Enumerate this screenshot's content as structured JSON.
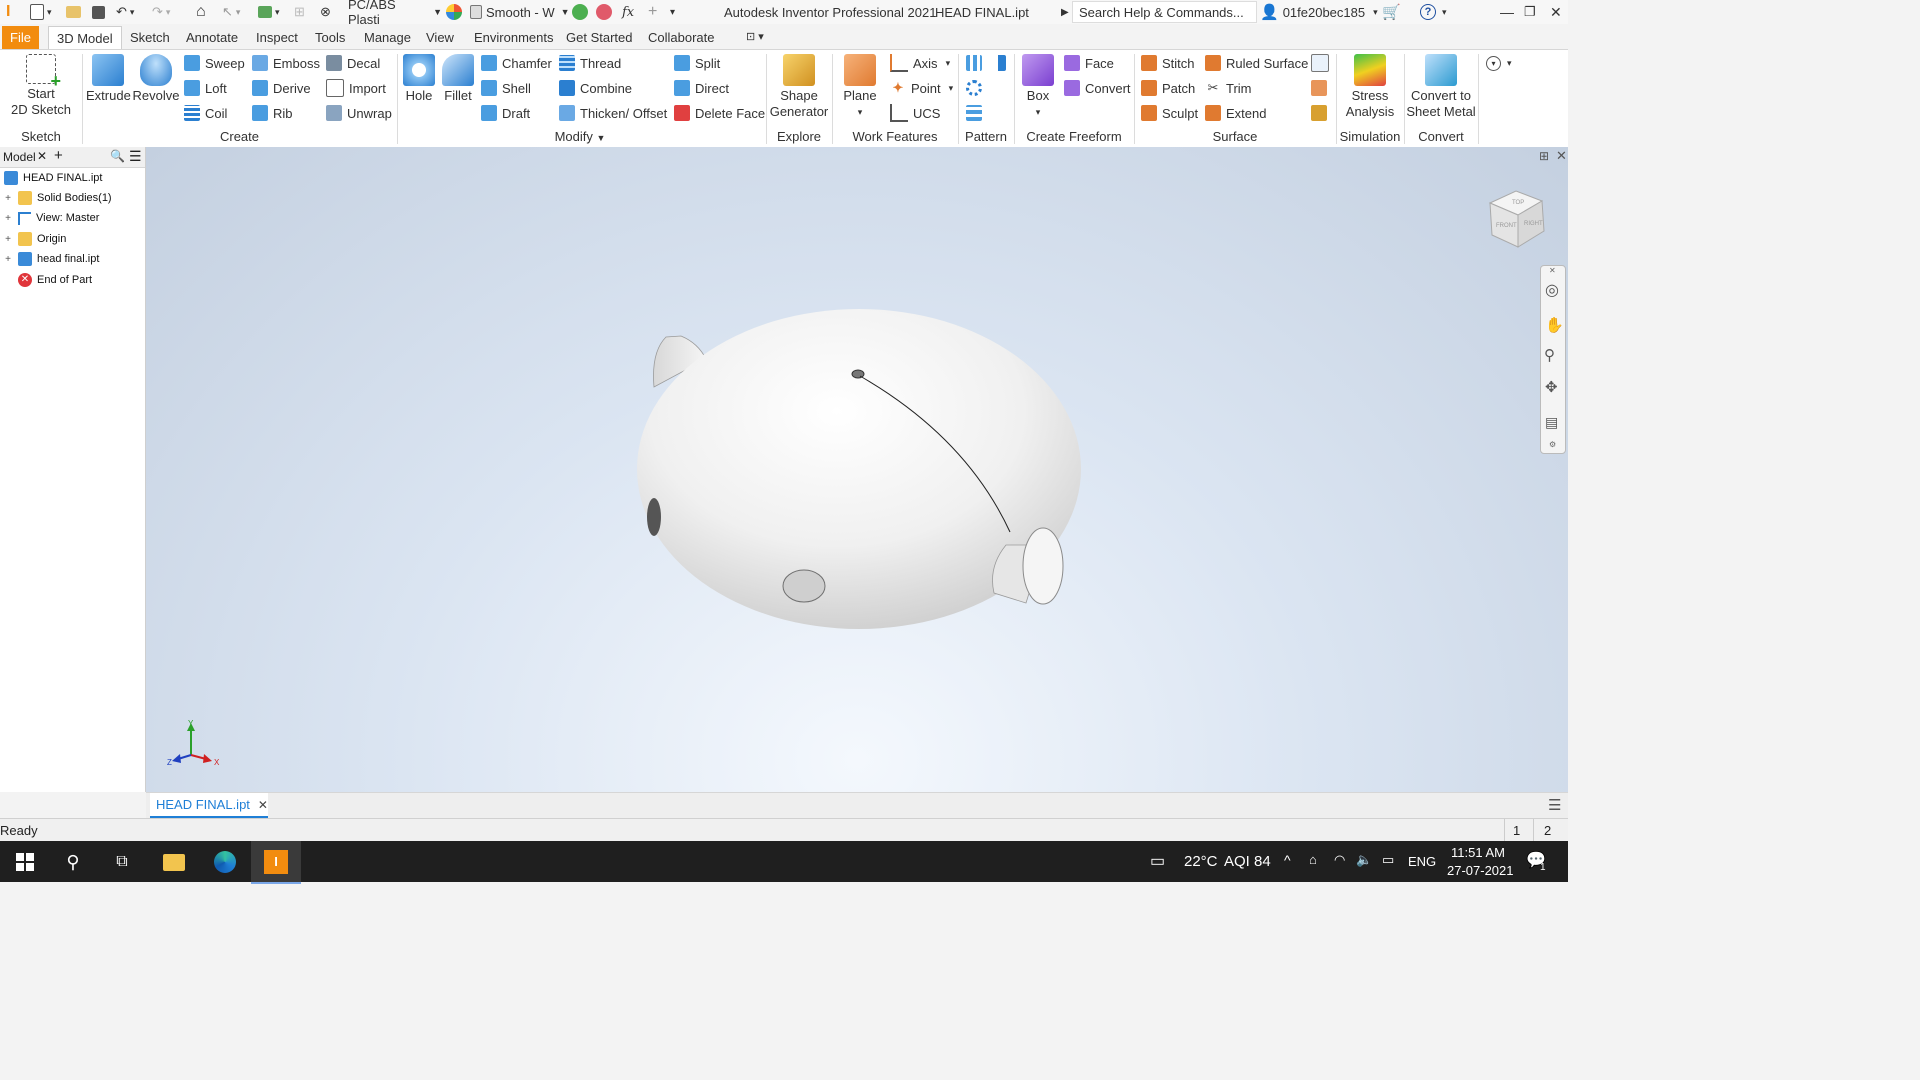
{
  "titlebar": {
    "material": "PC/ABS Plasti",
    "visual_style": "Smooth - W",
    "app_title": "Autodesk Inventor Professional 2021",
    "doc_title": "HEAD FINAL.ipt",
    "search_placeholder": "Search Help & Commands...",
    "user": "01fe20bec185"
  },
  "tabs": [
    {
      "label": "File"
    },
    {
      "label": "3D Model"
    },
    {
      "label": "Sketch"
    },
    {
      "label": "Annotate"
    },
    {
      "label": "Inspect"
    },
    {
      "label": "Tools"
    },
    {
      "label": "Manage"
    },
    {
      "label": "View"
    },
    {
      "label": "Environments"
    },
    {
      "label": "Get Started"
    },
    {
      "label": "Collaborate"
    }
  ],
  "ribbon": {
    "sketch": {
      "start_line1": "Start",
      "start_line2": "2D Sketch",
      "label": "Sketch"
    },
    "create": {
      "extrude": "Extrude",
      "revolve": "Revolve",
      "sweep": "Sweep",
      "loft": "Loft",
      "coil": "Coil",
      "emboss": "Emboss",
      "derive": "Derive",
      "rib": "Rib",
      "decal": "Decal",
      "import": "Import",
      "unwrap": "Unwrap",
      "label": "Create"
    },
    "modify": {
      "hole": "Hole",
      "fillet": "Fillet",
      "chamfer": "Chamfer",
      "shell": "Shell",
      "draft": "Draft",
      "thread": "Thread",
      "combine": "Combine",
      "thicken": "Thicken/ Offset",
      "split": "Split",
      "direct": "Direct",
      "delete_face": "Delete Face",
      "label": "Modify"
    },
    "explore": {
      "shape_line1": "Shape",
      "shape_line2": "Generator",
      "label": "Explore"
    },
    "work": {
      "plane": "Plane",
      "axis": "Axis",
      "point": "Point",
      "ucs": "UCS",
      "label": "Work Features"
    },
    "pattern": {
      "label": "Pattern"
    },
    "freeform": {
      "box": "Box",
      "face": "Face",
      "convert": "Convert",
      "label": "Create Freeform"
    },
    "surface": {
      "stitch": "Stitch",
      "patch": "Patch",
      "sculpt": "Sculpt",
      "ruled": "Ruled Surface",
      "trim": "Trim",
      "extend": "Extend",
      "label": "Surface"
    },
    "simulation": {
      "line1": "Stress",
      "line2": "Analysis",
      "label": "Simulation"
    },
    "convert": {
      "line1": "Convert to",
      "line2": "Sheet Metal",
      "label": "Convert"
    }
  },
  "browser": {
    "tab_label": "Model",
    "items": [
      {
        "label": "HEAD FINAL.ipt"
      },
      {
        "label": "Solid Bodies(1)"
      },
      {
        "label": "View: Master"
      },
      {
        "label": "Origin"
      },
      {
        "label": "head final.ipt"
      },
      {
        "label": "End of Part"
      }
    ]
  },
  "viewcube": {
    "top": "TOP",
    "front": "FRONT",
    "right": "RIGHT"
  },
  "triad": {
    "x": "X",
    "y": "Y",
    "z": "Z"
  },
  "doc_tab": {
    "label": "HEAD FINAL.ipt"
  },
  "status": {
    "text": "Ready",
    "count1": "1",
    "count2": "2"
  },
  "taskbar": {
    "weather": "22°C",
    "aqi": "AQI 84",
    "lang": "ENG",
    "time": "11:51 AM",
    "date": "27-07-2021",
    "notif": "1"
  },
  "colors": {
    "file_tab": "#f28c0f",
    "accent_blue": "#1f7fd6",
    "taskbar": "#1f1f1f"
  }
}
